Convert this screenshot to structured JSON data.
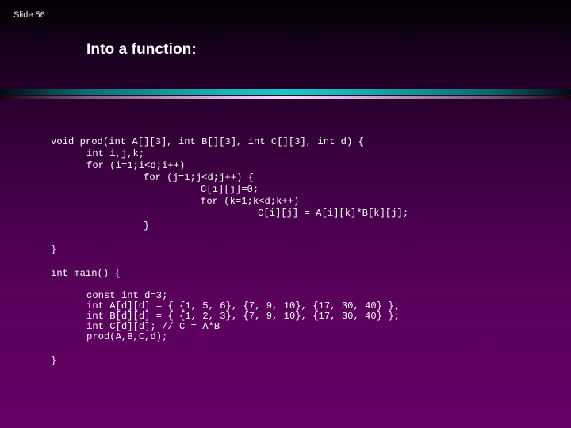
{
  "slide": {
    "number_label": "Slide 56",
    "title": "Into a function:"
  },
  "colors": {
    "background_top": "#000000",
    "background_bottom": "#660066",
    "divider_primary": "#1ac8c8",
    "divider_secondary": "#ffd8ff",
    "text": "#ffffff"
  },
  "code": {
    "lines": [
      "void prod(int A[][3], int B[][3], int C[][3], int d) {",
      "int i,j,k;",
      "for (i=1;i<d;i++)",
      "for (j=1;j<d;j++) {",
      "C[i][j]=0;",
      "for (k=1;k<d;k++)",
      "C[i][j] = A[i][k]*B[k][j];",
      "}",
      "}",
      "int main() {",
      "const int d=3;",
      "int A[d][d] = { {1, 5, 6}, {7, 9, 10}, {17, 30, 40} };",
      "int B[d][d] = { {1, 2, 3}, {7, 9, 10}, {17, 30, 40} };",
      "int C[d][d]; // C = A*B",
      "prod(A,B,C,d);",
      "}"
    ]
  }
}
